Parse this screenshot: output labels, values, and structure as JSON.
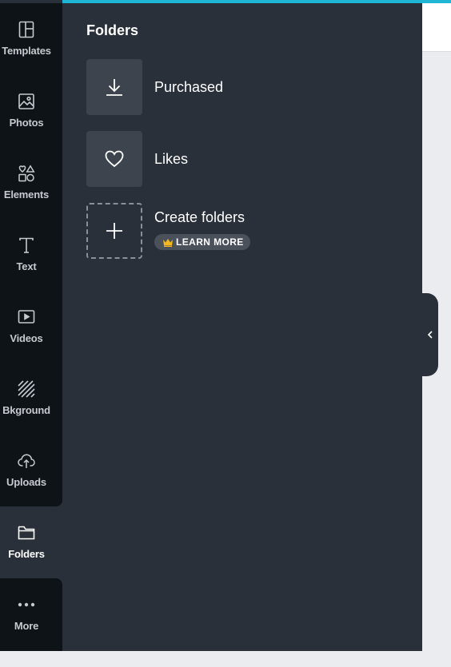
{
  "sidebar": {
    "items": [
      {
        "label": "Templates",
        "icon": "layout-icon"
      },
      {
        "label": "Photos",
        "icon": "photo-icon"
      },
      {
        "label": "Elements",
        "icon": "shapes-icon"
      },
      {
        "label": "Text",
        "icon": "text-icon"
      },
      {
        "label": "Videos",
        "icon": "video-icon"
      },
      {
        "label": "Bkground",
        "icon": "background-icon"
      },
      {
        "label": "Uploads",
        "icon": "upload-cloud-icon"
      },
      {
        "label": "Folders",
        "icon": "folder-icon",
        "active": true
      },
      {
        "label": "More",
        "icon": "more-dots-icon"
      }
    ]
  },
  "panel": {
    "title": "Folders",
    "folders": [
      {
        "label": "Purchased",
        "icon": "download-icon"
      },
      {
        "label": "Likes",
        "icon": "heart-icon"
      },
      {
        "label": "Create folders",
        "icon": "plus-icon",
        "badge": "LEARN MORE",
        "badge_icon": "crown-icon"
      }
    ]
  },
  "colors": {
    "accent_bar": "#1fb6d6",
    "sidebar_bg": "#0e1318",
    "panel_bg": "#293039",
    "tile_bg": "#3d444e",
    "crown": "#f5b81c"
  }
}
